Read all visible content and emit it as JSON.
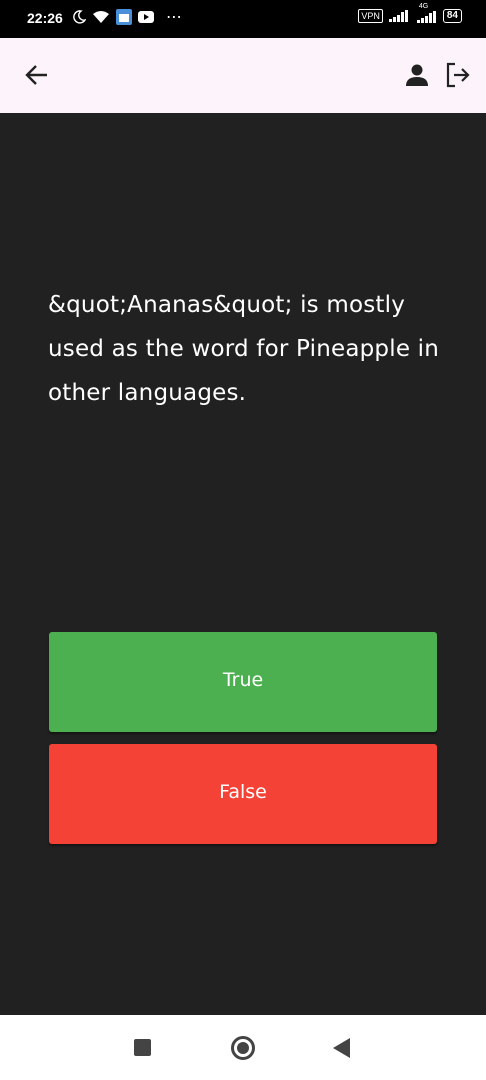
{
  "status_bar": {
    "time": "22:26",
    "vpn_label": "VPN",
    "network_type": "4G",
    "battery_level": "84"
  },
  "app_bar": {
    "back_icon": "arrow-left-icon",
    "account_icon": "person-icon",
    "logout_icon": "logout-icon"
  },
  "question": {
    "text": "&quot;Ananas&quot; is mostly used as the word for Pineapple in other languages."
  },
  "answers": {
    "true_label": "True",
    "false_label": "False"
  },
  "colors": {
    "background": "#212121",
    "app_bar": "#fdf4fb",
    "true_button": "#4caf50",
    "false_button": "#f44336"
  },
  "nav_bar": {
    "recents_icon": "square-icon",
    "home_icon": "circle-icon",
    "back_icon": "triangle-back-icon"
  }
}
